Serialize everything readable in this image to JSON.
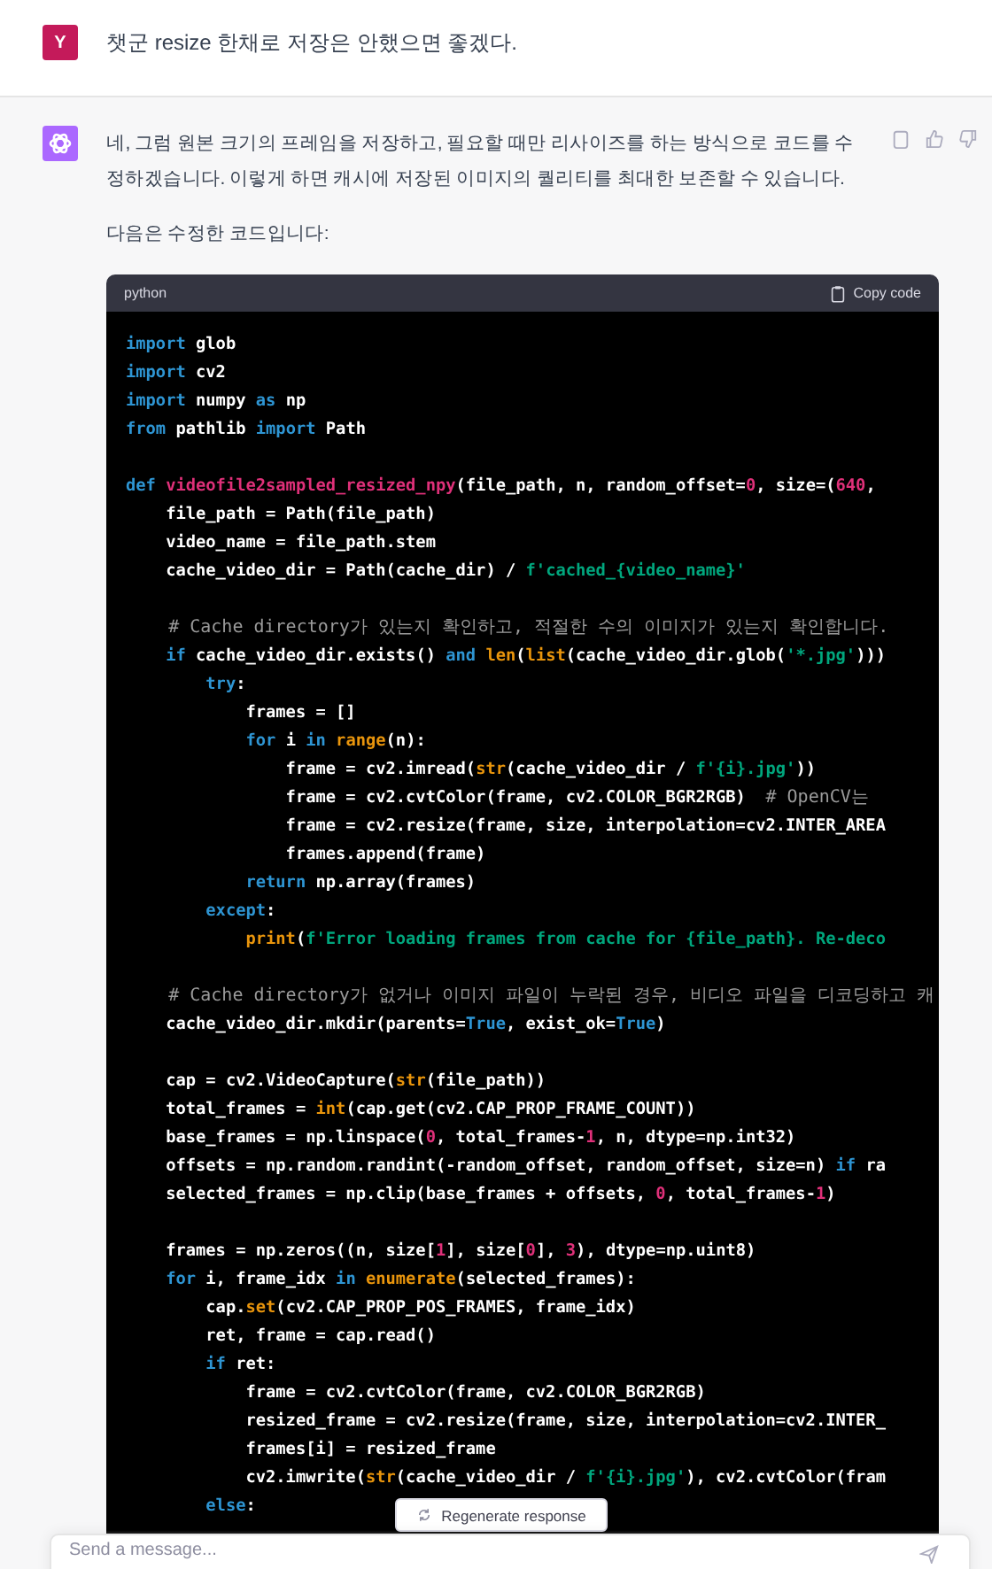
{
  "user_message": {
    "avatar": "Y",
    "text": "챗군 resize 한채로 저장은 안했으면 좋겠다."
  },
  "assistant_message": {
    "paragraphs": [
      "네, 그럼 원본 크기의 프레임을 저장하고, 필요할 때만 리사이즈를 하는 방식으로 코드를 수정하겠습니다. 이렇게 하면 캐시에 저장된 이미지의 퀄리티를 최대한 보존할 수 있습니다.",
      "다음은 수정한 코드입니다:"
    ],
    "code_block": {
      "language": "python",
      "copy_label": "Copy code",
      "lines": [
        {
          "kind": "code",
          "tokens": [
            {
              "kind": "kw",
              "text": "import"
            },
            {
              "kind": "plain",
              "text": " glob"
            }
          ]
        },
        {
          "kind": "code",
          "tokens": [
            {
              "kind": "kw",
              "text": "import"
            },
            {
              "kind": "plain",
              "text": " cv2"
            }
          ]
        },
        {
          "kind": "code",
          "tokens": [
            {
              "kind": "kw",
              "text": "import"
            },
            {
              "kind": "plain",
              "text": " numpy "
            },
            {
              "kind": "kw",
              "text": "as"
            },
            {
              "kind": "plain",
              "text": " np"
            }
          ]
        },
        {
          "kind": "code",
          "tokens": [
            {
              "kind": "kw",
              "text": "from"
            },
            {
              "kind": "plain",
              "text": " pathlib "
            },
            {
              "kind": "kw",
              "text": "import"
            },
            {
              "kind": "plain",
              "text": " Path"
            }
          ]
        },
        {
          "kind": "blank"
        },
        {
          "kind": "code",
          "tokens": [
            {
              "kind": "kw",
              "text": "def "
            },
            {
              "kind": "name",
              "text": "videofile2sampled_resized_npy"
            },
            {
              "kind": "plain",
              "text": "(file_path, n, random_offset="
            },
            {
              "kind": "num",
              "text": "0"
            },
            {
              "kind": "plain",
              "text": ", size=("
            },
            {
              "kind": "num",
              "text": "640"
            },
            {
              "kind": "plain",
              "text": ","
            }
          ]
        },
        {
          "kind": "code",
          "tokens": [
            {
              "kind": "plain",
              "text": "    file_path = Path(file_path)"
            }
          ]
        },
        {
          "kind": "code",
          "tokens": [
            {
              "kind": "plain",
              "text": "    video_name = file_path.stem"
            }
          ]
        },
        {
          "kind": "code",
          "tokens": [
            {
              "kind": "plain",
              "text": "    cache_video_dir = Path(cache_dir) / "
            },
            {
              "kind": "str",
              "text": "f'cached_{video_name}'"
            }
          ]
        },
        {
          "kind": "blank"
        },
        {
          "kind": "code",
          "tokens": [
            {
              "kind": "comment",
              "text": "    # Cache directory가 있는지 확인하고, 적절한 수의 이미지가 있는지 확인합니다."
            }
          ]
        },
        {
          "kind": "code",
          "tokens": [
            {
              "kind": "kw",
              "text": "    if"
            },
            {
              "kind": "plain",
              "text": " cache_video_dir.exists() "
            },
            {
              "kind": "kw",
              "text": "and "
            },
            {
              "kind": "builtin",
              "text": "len"
            },
            {
              "kind": "plain",
              "text": "("
            },
            {
              "kind": "builtin",
              "text": "list"
            },
            {
              "kind": "plain",
              "text": "(cache_video_dir.glob("
            },
            {
              "kind": "str",
              "text": "'*.jpg'"
            },
            {
              "kind": "plain",
              "text": ")))"
            }
          ]
        },
        {
          "kind": "code",
          "tokens": [
            {
              "kind": "kw",
              "text": "        try"
            },
            {
              "kind": "plain",
              "text": ":"
            }
          ]
        },
        {
          "kind": "code",
          "tokens": [
            {
              "kind": "plain",
              "text": "            frames = []"
            }
          ]
        },
        {
          "kind": "code",
          "tokens": [
            {
              "kind": "kw",
              "text": "            for"
            },
            {
              "kind": "plain",
              "text": " i "
            },
            {
              "kind": "kw",
              "text": "in "
            },
            {
              "kind": "builtin",
              "text": "range"
            },
            {
              "kind": "plain",
              "text": "(n):"
            }
          ]
        },
        {
          "kind": "code",
          "tokens": [
            {
              "kind": "plain",
              "text": "                frame = cv2.imread("
            },
            {
              "kind": "builtin",
              "text": "str"
            },
            {
              "kind": "plain",
              "text": "(cache_video_dir / "
            },
            {
              "kind": "str",
              "text": "f'{i}.jpg'"
            },
            {
              "kind": "plain",
              "text": "))"
            }
          ]
        },
        {
          "kind": "code",
          "tokens": [
            {
              "kind": "plain",
              "text": "                frame = cv2.cvtColor(frame, cv2.COLOR_BGR2RGB)  "
            },
            {
              "kind": "comment",
              "text": "# OpenCV는"
            }
          ]
        },
        {
          "kind": "code",
          "tokens": [
            {
              "kind": "plain",
              "text": "                frame = cv2.resize(frame, size, interpolation=cv2.INTER_AREA"
            }
          ]
        },
        {
          "kind": "code",
          "tokens": [
            {
              "kind": "plain",
              "text": "                frames.append(frame)"
            }
          ]
        },
        {
          "kind": "code",
          "tokens": [
            {
              "kind": "kw",
              "text": "            return"
            },
            {
              "kind": "plain",
              "text": " np.array(frames)"
            }
          ]
        },
        {
          "kind": "code",
          "tokens": [
            {
              "kind": "kw",
              "text": "        except"
            },
            {
              "kind": "plain",
              "text": ":"
            }
          ]
        },
        {
          "kind": "code",
          "tokens": [
            {
              "kind": "builtin",
              "text": "            print"
            },
            {
              "kind": "plain",
              "text": "("
            },
            {
              "kind": "str",
              "text": "f'Error loading frames from cache for {file_path}. Re-deco"
            }
          ]
        },
        {
          "kind": "blank"
        },
        {
          "kind": "code",
          "tokens": [
            {
              "kind": "comment",
              "text": "    # Cache directory가 없거나 이미지 파일이 누락된 경우, 비디오 파일을 디코딩하고 캐"
            }
          ]
        },
        {
          "kind": "code",
          "tokens": [
            {
              "kind": "plain",
              "text": "    cache_video_dir.mkdir(parents="
            },
            {
              "kind": "kw",
              "text": "True"
            },
            {
              "kind": "plain",
              "text": ", exist_ok="
            },
            {
              "kind": "kw",
              "text": "True"
            },
            {
              "kind": "plain",
              "text": ")"
            }
          ]
        },
        {
          "kind": "blank"
        },
        {
          "kind": "code",
          "tokens": [
            {
              "kind": "plain",
              "text": "    cap = cv2.VideoCapture("
            },
            {
              "kind": "builtin",
              "text": "str"
            },
            {
              "kind": "plain",
              "text": "(file_path))"
            }
          ]
        },
        {
          "kind": "code",
          "tokens": [
            {
              "kind": "plain",
              "text": "    total_frames = "
            },
            {
              "kind": "builtin",
              "text": "int"
            },
            {
              "kind": "plain",
              "text": "(cap.get(cv2.CAP_PROP_FRAME_COUNT))"
            }
          ]
        },
        {
          "kind": "code",
          "tokens": [
            {
              "kind": "plain",
              "text": "    base_frames = np.linspace("
            },
            {
              "kind": "num",
              "text": "0"
            },
            {
              "kind": "plain",
              "text": ", total_frames-"
            },
            {
              "kind": "num",
              "text": "1"
            },
            {
              "kind": "plain",
              "text": ", n, dtype=np.int32)"
            }
          ]
        },
        {
          "kind": "code",
          "tokens": [
            {
              "kind": "plain",
              "text": "    offsets = np.random.randint(-random_offset, random_offset, size=n) "
            },
            {
              "kind": "kw",
              "text": "if"
            },
            {
              "kind": "plain",
              "text": " ra"
            }
          ]
        },
        {
          "kind": "code",
          "tokens": [
            {
              "kind": "plain",
              "text": "    selected_frames = np.clip(base_frames + offsets, "
            },
            {
              "kind": "num",
              "text": "0"
            },
            {
              "kind": "plain",
              "text": ", total_frames-"
            },
            {
              "kind": "num",
              "text": "1"
            },
            {
              "kind": "plain",
              "text": ")"
            }
          ]
        },
        {
          "kind": "blank"
        },
        {
          "kind": "code",
          "tokens": [
            {
              "kind": "plain",
              "text": "    frames = np.zeros((n, size["
            },
            {
              "kind": "num",
              "text": "1"
            },
            {
              "kind": "plain",
              "text": "], size["
            },
            {
              "kind": "num",
              "text": "0"
            },
            {
              "kind": "plain",
              "text": "], "
            },
            {
              "kind": "num",
              "text": "3"
            },
            {
              "kind": "plain",
              "text": "), dtype=np.uint8)"
            }
          ]
        },
        {
          "kind": "code",
          "tokens": [
            {
              "kind": "kw",
              "text": "    for"
            },
            {
              "kind": "plain",
              "text": " i, frame_idx "
            },
            {
              "kind": "kw",
              "text": "in "
            },
            {
              "kind": "builtin",
              "text": "enumerate"
            },
            {
              "kind": "plain",
              "text": "(selected_frames):"
            }
          ]
        },
        {
          "kind": "code",
          "tokens": [
            {
              "kind": "plain",
              "text": "        cap."
            },
            {
              "kind": "builtin",
              "text": "set"
            },
            {
              "kind": "plain",
              "text": "(cv2.CAP_PROP_POS_FRAMES, frame_idx)"
            }
          ]
        },
        {
          "kind": "code",
          "tokens": [
            {
              "kind": "plain",
              "text": "        ret, frame = cap.read()"
            }
          ]
        },
        {
          "kind": "code",
          "tokens": [
            {
              "kind": "kw",
              "text": "        if"
            },
            {
              "kind": "plain",
              "text": " ret:"
            }
          ]
        },
        {
          "kind": "code",
          "tokens": [
            {
              "kind": "plain",
              "text": "            frame = cv2.cvtColor(frame, cv2.COLOR_BGR2RGB)"
            }
          ]
        },
        {
          "kind": "code",
          "tokens": [
            {
              "kind": "plain",
              "text": "            resized_frame = cv2.resize(frame, size, interpolation=cv2.INTER_"
            }
          ]
        },
        {
          "kind": "code",
          "tokens": [
            {
              "kind": "plain",
              "text": "            frames[i] = resized_frame"
            }
          ]
        },
        {
          "kind": "code",
          "tokens": [
            {
              "kind": "plain",
              "text": "            cv2.imwrite("
            },
            {
              "kind": "builtin",
              "text": "str"
            },
            {
              "kind": "plain",
              "text": "(cache_video_dir / "
            },
            {
              "kind": "str",
              "text": "f'{i}.jpg'"
            },
            {
              "kind": "plain",
              "text": "), cv2.cvtColor(fram"
            }
          ]
        },
        {
          "kind": "code",
          "tokens": [
            {
              "kind": "kw",
              "text": "        else"
            },
            {
              "kind": "plain",
              "text": ":"
            }
          ]
        }
      ]
    }
  },
  "regenerate_button": {
    "label": "Regenerate response"
  },
  "composer": {
    "placeholder": "Send a message..."
  }
}
